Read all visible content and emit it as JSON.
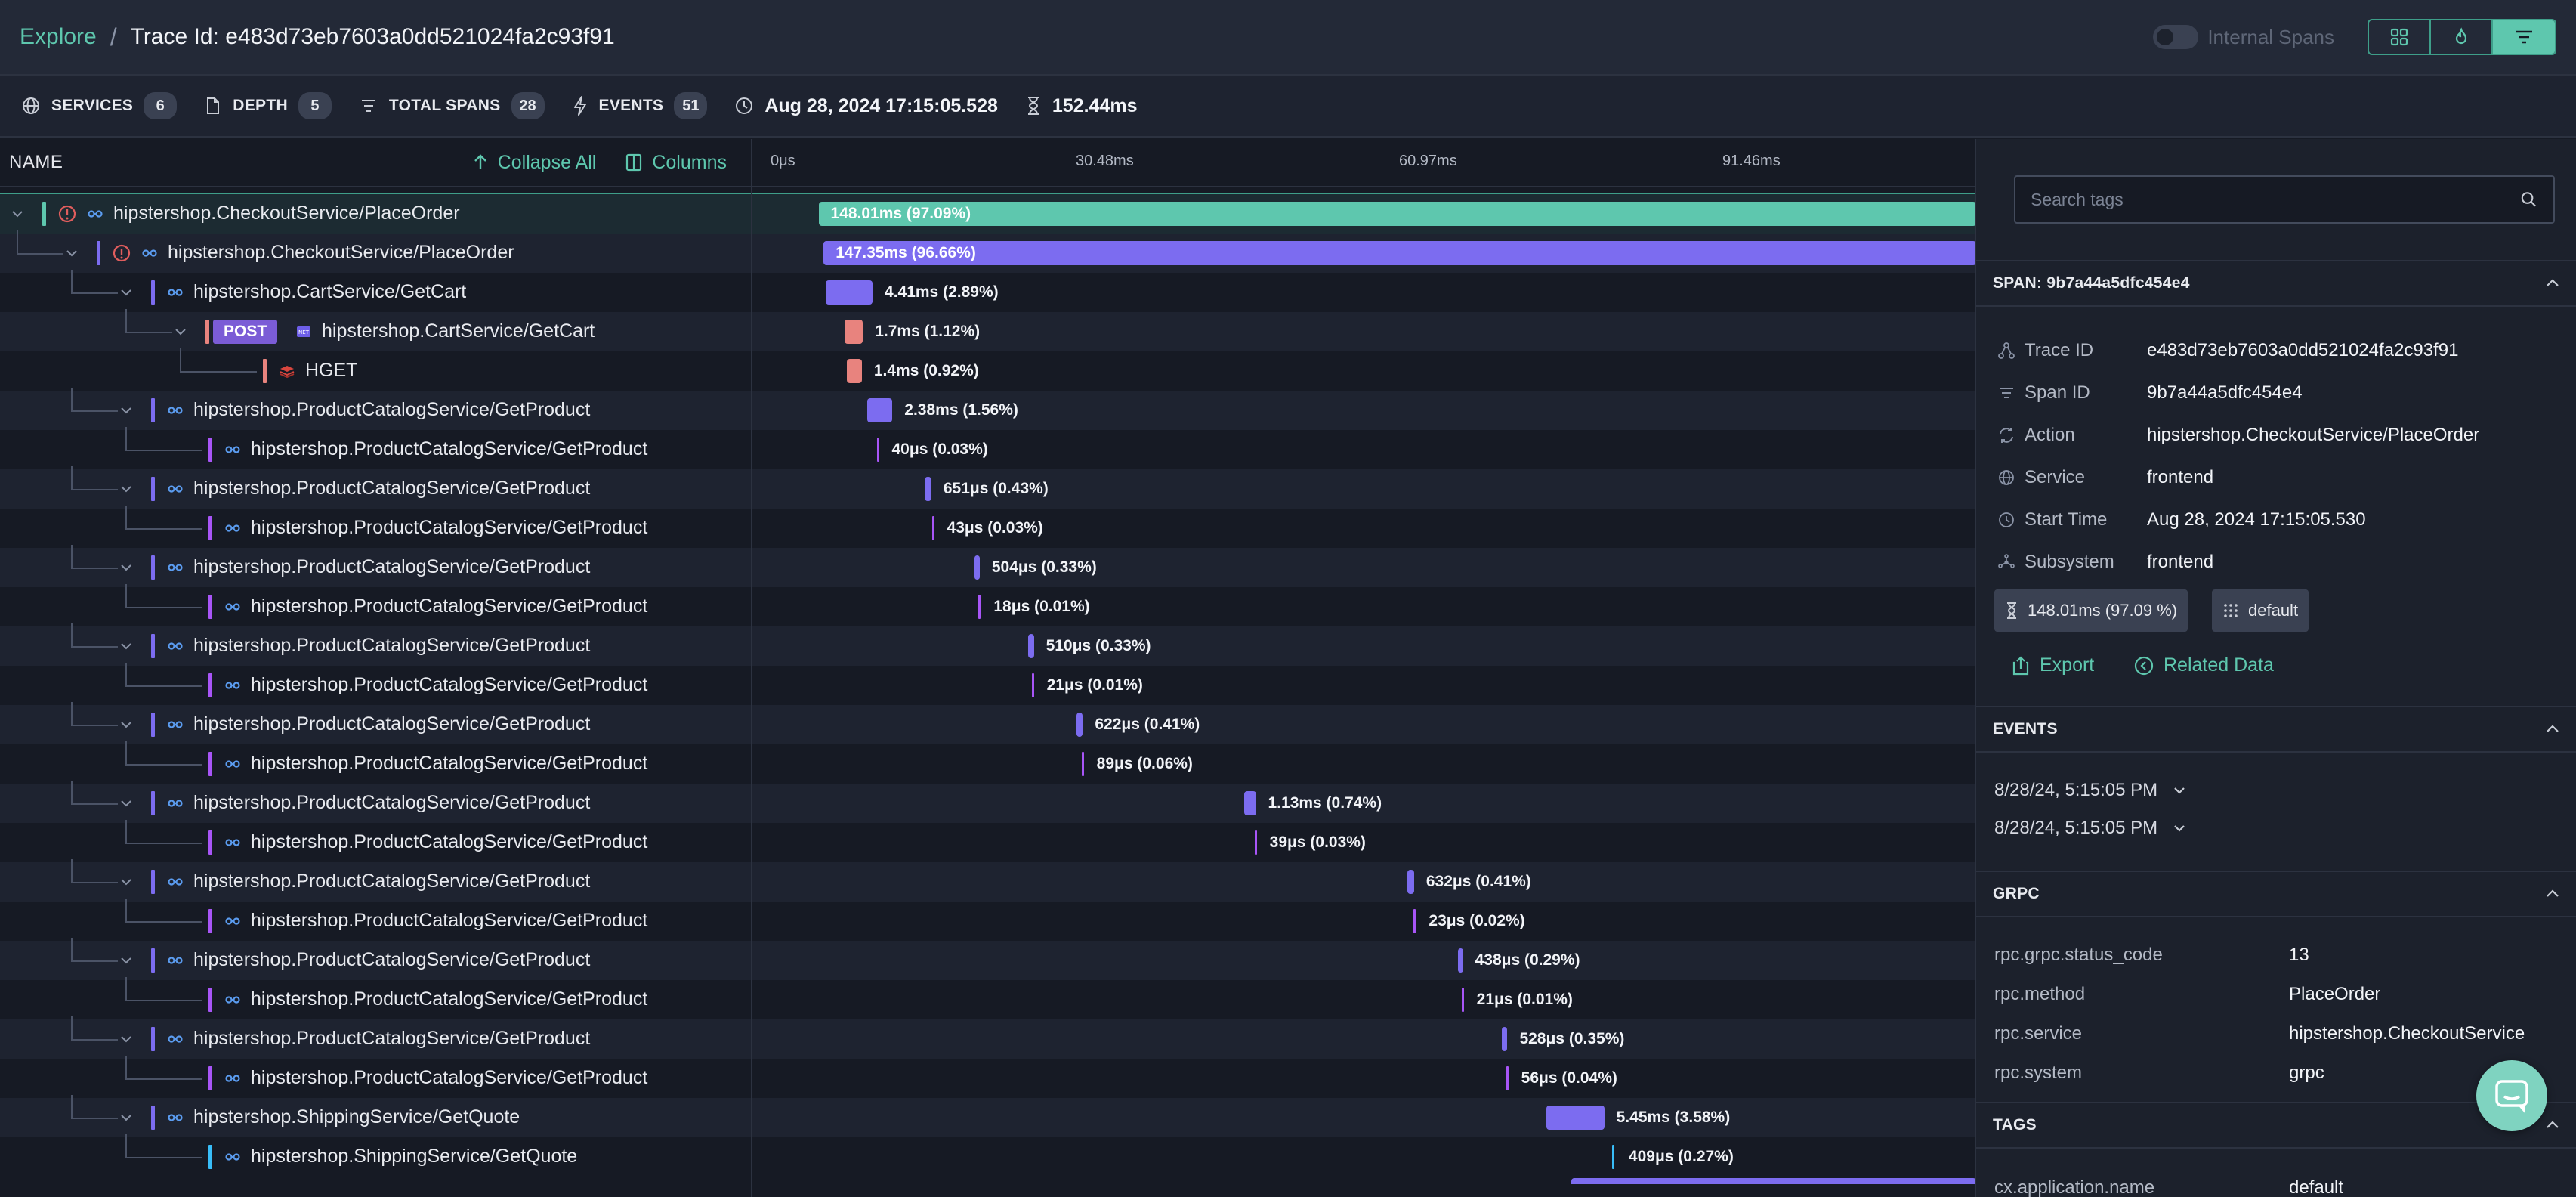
{
  "header": {
    "breadcrumb_root": "Explore",
    "breadcrumb_sep": "/",
    "trace_title": "Trace Id: e483d73eb7603a0dd521024fa2c93f91",
    "internal_spans_label": "Internal Spans",
    "internal_spans_on": false,
    "view_buttons": [
      "flow-icon",
      "flame-icon",
      "timeline-icon"
    ],
    "active_view": "timeline-icon"
  },
  "stats": {
    "services_label": "SERVICES",
    "services_count": "6",
    "depth_label": "DEPTH",
    "depth_count": "5",
    "total_spans_label": "TOTAL SPANS",
    "total_spans_count": "28",
    "events_label": "EVENTS",
    "events_count": "51",
    "start_time": "Aug 28, 2024 17:15:05.528",
    "duration": "152.44ms"
  },
  "tree_header": {
    "name_label": "NAME",
    "collapse_all": "Collapse All",
    "columns": "Columns"
  },
  "timeline": {
    "total_ms": 152.44,
    "ticks": [
      "0μs",
      "30.48ms",
      "60.97ms",
      "91.46ms"
    ]
  },
  "spans": [
    {
      "name": "hipstershop.CheckoutService/PlaceOrder",
      "depth": 0,
      "expanded": true,
      "error": true,
      "service_color": "#5ec7ae",
      "icon": "link-icon",
      "start_ms": 4.52,
      "dur_ms": 148.01,
      "label": "148.01ms (97.09%)",
      "bar_color": "#5ec7ae",
      "selected": true
    },
    {
      "name": "hipstershop.CheckoutService/PlaceOrder",
      "depth": 1,
      "expanded": true,
      "error": true,
      "service_color": "#7c6cf0",
      "icon": "link-icon",
      "start_ms": 5.0,
      "dur_ms": 147.35,
      "label": "147.35ms (96.66%)",
      "bar_color": "#7c6cf0"
    },
    {
      "name": "hipstershop.CartService/GetCart",
      "depth": 2,
      "expanded": true,
      "service_color": "#7c6cf0",
      "icon": "link-icon",
      "start_ms": 5.2,
      "dur_ms": 4.41,
      "label": "4.41ms (2.89%)",
      "bar_color": "#7c6cf0"
    },
    {
      "name": "hipstershop.CartService/GetCart",
      "depth": 3,
      "expanded": true,
      "service_color": "#e8837e",
      "icon": "net-icon",
      "method": "POST",
      "start_ms": 7.0,
      "dur_ms": 1.7,
      "label": "1.7ms (1.12%)",
      "bar_color": "#e8837e"
    },
    {
      "name": "HGET",
      "depth": 4,
      "leaf": true,
      "service_color": "#e8837e",
      "icon": "redis-icon",
      "start_ms": 7.2,
      "dur_ms": 1.4,
      "label": "1.4ms (0.92%)",
      "bar_color": "#e8837e"
    },
    {
      "name": "hipstershop.ProductCatalogService/GetProduct",
      "depth": 2,
      "expanded": true,
      "service_color": "#7c6cf0",
      "icon": "link-icon",
      "start_ms": 9.1,
      "dur_ms": 2.38,
      "label": "2.38ms (1.56%)",
      "bar_color": "#7c6cf0"
    },
    {
      "name": "hipstershop.ProductCatalogService/GetProduct",
      "depth": 3,
      "leaf": true,
      "service_color": "#a855f7",
      "icon": "link-icon",
      "start_ms": 10.0,
      "dur_ms": 0.04,
      "label": "40μs (0.03%)",
      "bar_color": "#a855f7"
    },
    {
      "name": "hipstershop.ProductCatalogService/GetProduct",
      "depth": 2,
      "expanded": true,
      "service_color": "#7c6cf0",
      "icon": "link-icon",
      "start_ms": 14.5,
      "dur_ms": 0.651,
      "label": "651μs (0.43%)",
      "bar_color": "#7c6cf0"
    },
    {
      "name": "hipstershop.ProductCatalogService/GetProduct",
      "depth": 3,
      "leaf": true,
      "service_color": "#a855f7",
      "icon": "link-icon",
      "start_ms": 15.2,
      "dur_ms": 0.043,
      "label": "43μs (0.03%)",
      "bar_color": "#a855f7"
    },
    {
      "name": "hipstershop.ProductCatalogService/GetProduct",
      "depth": 2,
      "expanded": true,
      "service_color": "#7c6cf0",
      "icon": "link-icon",
      "start_ms": 19.2,
      "dur_ms": 0.504,
      "label": "504μs (0.33%)",
      "bar_color": "#7c6cf0"
    },
    {
      "name": "hipstershop.ProductCatalogService/GetProduct",
      "depth": 3,
      "leaf": true,
      "service_color": "#a855f7",
      "icon": "link-icon",
      "start_ms": 19.6,
      "dur_ms": 0.018,
      "label": "18μs (0.01%)",
      "bar_color": "#a855f7"
    },
    {
      "name": "hipstershop.ProductCatalogService/GetProduct",
      "depth": 2,
      "expanded": true,
      "service_color": "#7c6cf0",
      "icon": "link-icon",
      "start_ms": 24.3,
      "dur_ms": 0.51,
      "label": "510μs (0.33%)",
      "bar_color": "#7c6cf0"
    },
    {
      "name": "hipstershop.ProductCatalogService/GetProduct",
      "depth": 3,
      "leaf": true,
      "service_color": "#a855f7",
      "icon": "link-icon",
      "start_ms": 24.6,
      "dur_ms": 0.021,
      "label": "21μs (0.01%)",
      "bar_color": "#a855f7"
    },
    {
      "name": "hipstershop.ProductCatalogService/GetProduct",
      "depth": 2,
      "expanded": true,
      "service_color": "#7c6cf0",
      "icon": "link-icon",
      "start_ms": 28.8,
      "dur_ms": 0.622,
      "label": "622μs (0.41%)",
      "bar_color": "#7c6cf0"
    },
    {
      "name": "hipstershop.ProductCatalogService/GetProduct",
      "depth": 3,
      "leaf": true,
      "service_color": "#a855f7",
      "icon": "link-icon",
      "start_ms": 29.3,
      "dur_ms": 0.089,
      "label": "89μs (0.06%)",
      "bar_color": "#a855f7"
    },
    {
      "name": "hipstershop.ProductCatalogService/GetProduct",
      "depth": 2,
      "expanded": true,
      "service_color": "#7c6cf0",
      "icon": "link-icon",
      "start_ms": 44.6,
      "dur_ms": 1.13,
      "label": "1.13ms (0.74%)",
      "bar_color": "#7c6cf0"
    },
    {
      "name": "hipstershop.ProductCatalogService/GetProduct",
      "depth": 3,
      "leaf": true,
      "service_color": "#a855f7",
      "icon": "link-icon",
      "start_ms": 45.6,
      "dur_ms": 0.039,
      "label": "39μs (0.03%)",
      "bar_color": "#a855f7"
    },
    {
      "name": "hipstershop.ProductCatalogService/GetProduct",
      "depth": 2,
      "expanded": true,
      "service_color": "#7c6cf0",
      "icon": "link-icon",
      "start_ms": 60.0,
      "dur_ms": 0.632,
      "label": "632μs (0.41%)",
      "bar_color": "#7c6cf0"
    },
    {
      "name": "hipstershop.ProductCatalogService/GetProduct",
      "depth": 3,
      "leaf": true,
      "service_color": "#a855f7",
      "icon": "link-icon",
      "start_ms": 60.6,
      "dur_ms": 0.023,
      "label": "23μs (0.02%)",
      "bar_color": "#a855f7"
    },
    {
      "name": "hipstershop.ProductCatalogService/GetProduct",
      "depth": 2,
      "expanded": true,
      "service_color": "#7c6cf0",
      "icon": "link-icon",
      "start_ms": 64.8,
      "dur_ms": 0.438,
      "label": "438μs (0.29%)",
      "bar_color": "#7c6cf0"
    },
    {
      "name": "hipstershop.ProductCatalogService/GetProduct",
      "depth": 3,
      "leaf": true,
      "service_color": "#a855f7",
      "icon": "link-icon",
      "start_ms": 65.1,
      "dur_ms": 0.021,
      "label": "21μs (0.01%)",
      "bar_color": "#a855f7"
    },
    {
      "name": "hipstershop.ProductCatalogService/GetProduct",
      "depth": 2,
      "expanded": true,
      "service_color": "#7c6cf0",
      "icon": "link-icon",
      "start_ms": 68.9,
      "dur_ms": 0.528,
      "label": "528μs (0.35%)",
      "bar_color": "#7c6cf0"
    },
    {
      "name": "hipstershop.ProductCatalogService/GetProduct",
      "depth": 3,
      "leaf": true,
      "service_color": "#a855f7",
      "icon": "link-icon",
      "start_ms": 69.3,
      "dur_ms": 0.056,
      "label": "56μs (0.04%)",
      "bar_color": "#a855f7"
    },
    {
      "name": "hipstershop.ShippingService/GetQuote",
      "depth": 2,
      "expanded": true,
      "service_color": "#7c6cf0",
      "icon": "link-icon",
      "start_ms": 73.1,
      "dur_ms": 5.45,
      "label": "5.45ms (3.58%)",
      "bar_color": "#7c6cf0"
    },
    {
      "name": "hipstershop.ShippingService/GetQuote",
      "depth": 3,
      "leaf": true,
      "service_color": "#38bdf8",
      "icon": "link-icon",
      "start_ms": 79.3,
      "dur_ms": 0.409,
      "label": "409μs (0.27%)",
      "bar_color": "#38bdf8"
    }
  ],
  "detail": {
    "search_placeholder": "Search tags",
    "span_title": "SPAN: 9b7a44a5dfc454e4",
    "fields": [
      {
        "icon": "trace-icon",
        "label": "Trace ID",
        "value": "e483d73eb7603a0dd521024fa2c93f91"
      },
      {
        "icon": "span-icon",
        "label": "Span ID",
        "value": "9b7a44a5dfc454e4"
      },
      {
        "icon": "action-icon",
        "label": "Action",
        "value": "hipstershop.CheckoutService/PlaceOrder"
      },
      {
        "icon": "globe-icon",
        "label": "Service",
        "value": "frontend"
      },
      {
        "icon": "clock-icon",
        "label": "Start Time",
        "value": "Aug 28, 2024 17:15:05.530"
      },
      {
        "icon": "subsystem-icon",
        "label": "Subsystem",
        "value": "frontend"
      }
    ],
    "duration_chip": "148.01ms (97.09 %)",
    "namespace_chip": "default",
    "export_label": "Export",
    "related_label": "Related Data",
    "events_title": "EVENTS",
    "events": [
      "8/28/24, 5:15:05 PM",
      "8/28/24, 5:15:05 PM"
    ],
    "grpc_title": "GRPC",
    "grpc": [
      {
        "key": "rpc.grpc.status_code",
        "value": "13"
      },
      {
        "key": "rpc.method",
        "value": "PlaceOrder"
      },
      {
        "key": "rpc.service",
        "value": "hipstershop.CheckoutService"
      },
      {
        "key": "rpc.system",
        "value": "grpc"
      }
    ],
    "tags_title": "TAGS",
    "tags": [
      {
        "key": "cx.application.name",
        "value": "default"
      }
    ]
  }
}
